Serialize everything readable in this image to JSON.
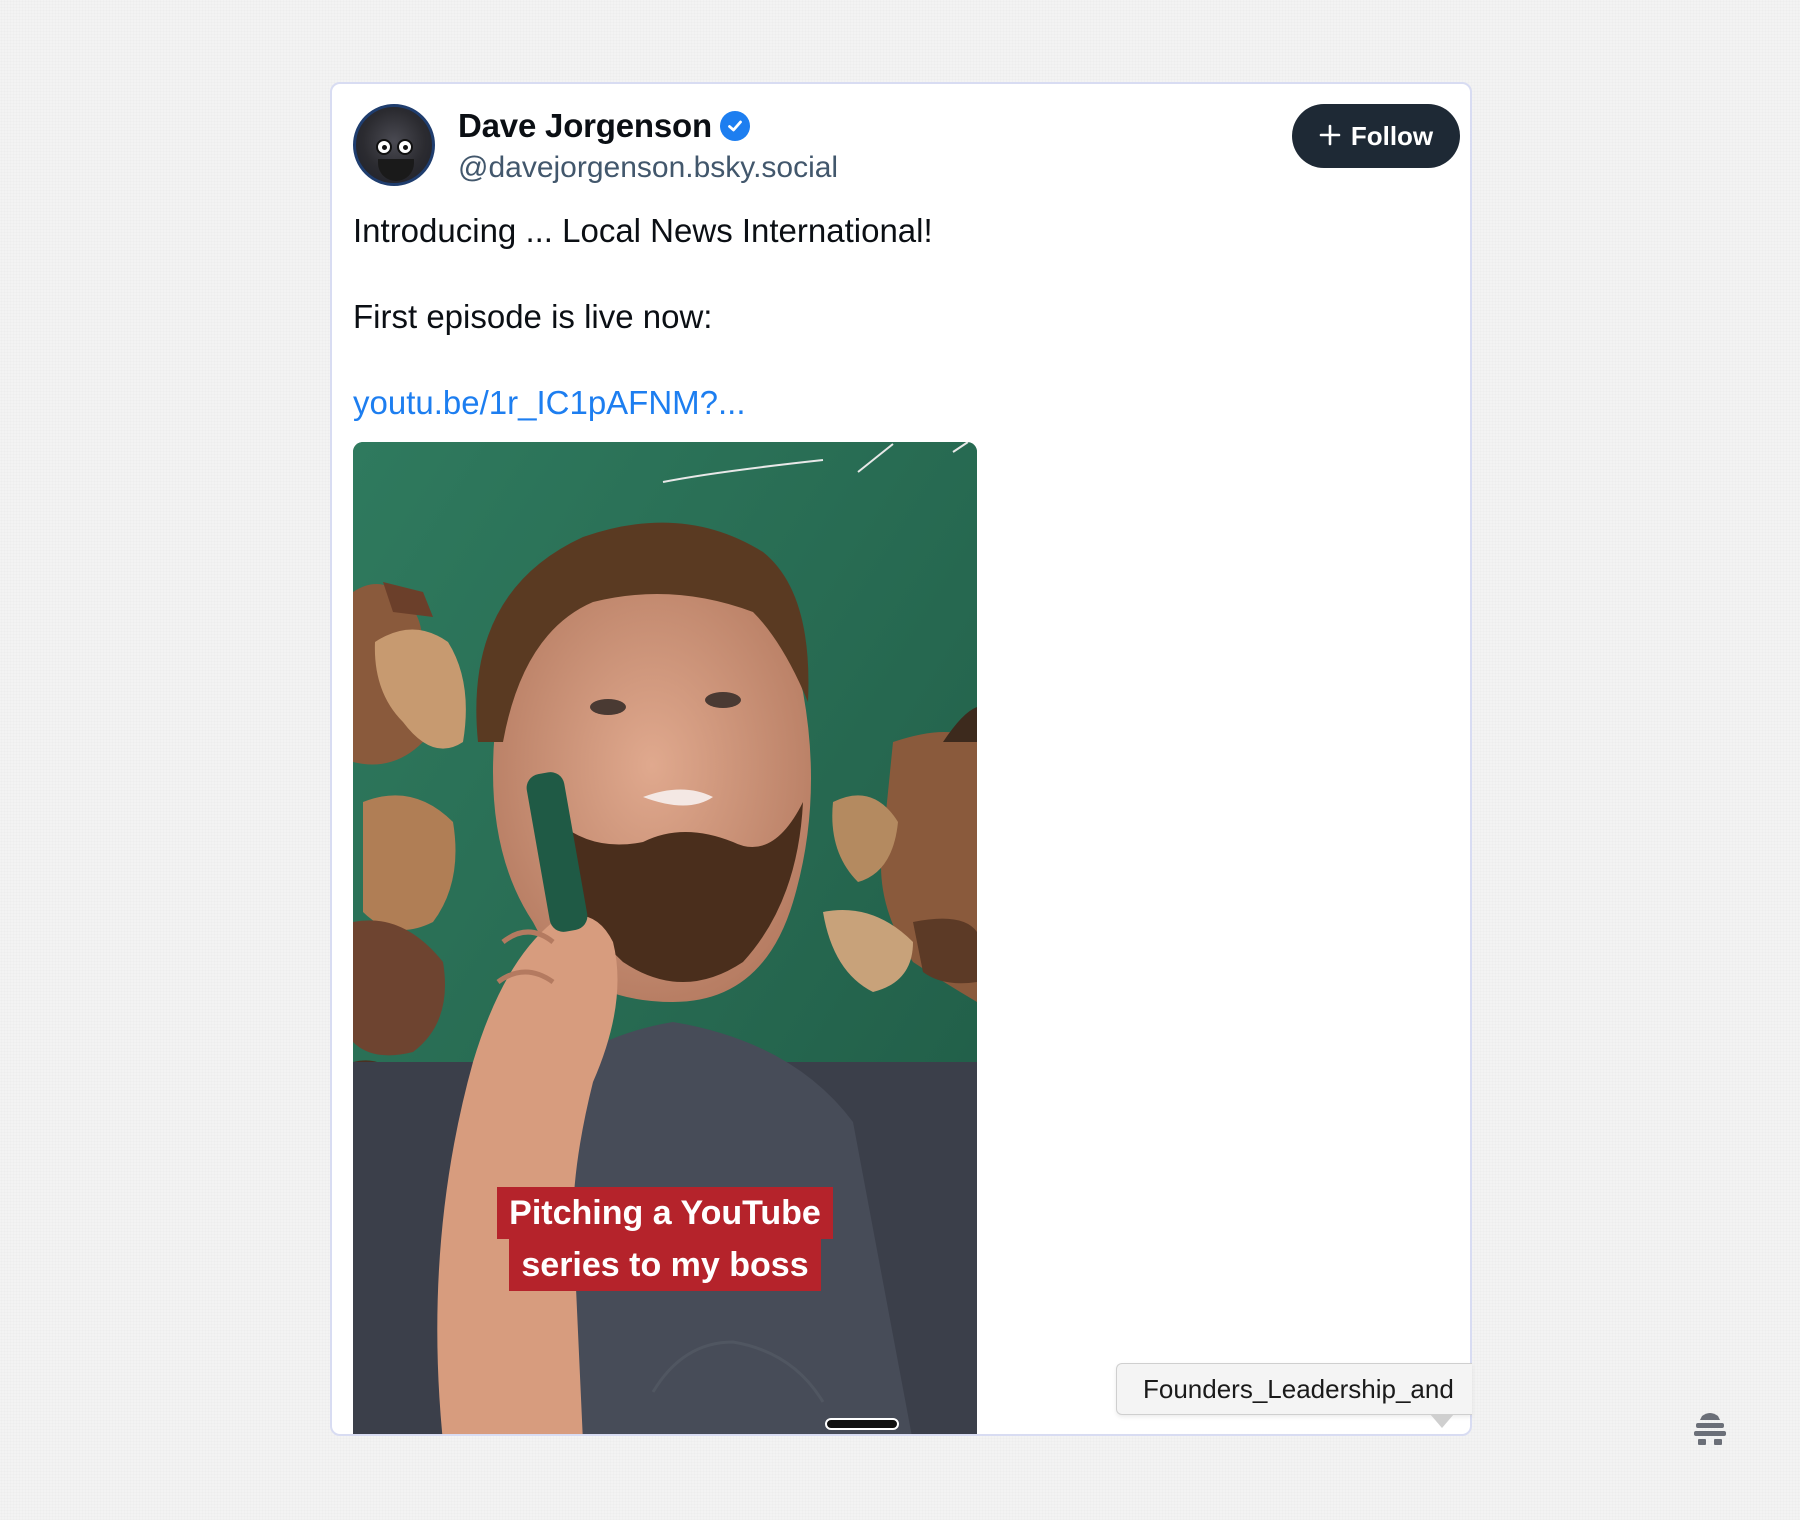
{
  "post": {
    "author": {
      "display_name": "Dave Jorgenson",
      "handle": "@davejorgenson.bsky.social",
      "verified": true,
      "avatar_icon": "avatar-googly-eyes"
    },
    "follow_button": {
      "icon": "plus-icon",
      "label": "Follow"
    },
    "text_line1": "Introducing ... Local News International!",
    "text_line2": "First episode is live now:",
    "link": "youtu.be/1r_IC1pAFNM?...",
    "video": {
      "caption_line1": "Pitching a YouTube",
      "caption_line2": "series to my boss"
    }
  },
  "tooltip": {
    "text": "Founders_Leadership_and"
  },
  "corner_icon": "stacked-logo-icon",
  "colors": {
    "link": "#1d7ef0",
    "verified": "#1d7ef0",
    "follow_bg": "#1e2935",
    "caption_bg": "#b5232b",
    "card_border": "#d8dcf2"
  }
}
